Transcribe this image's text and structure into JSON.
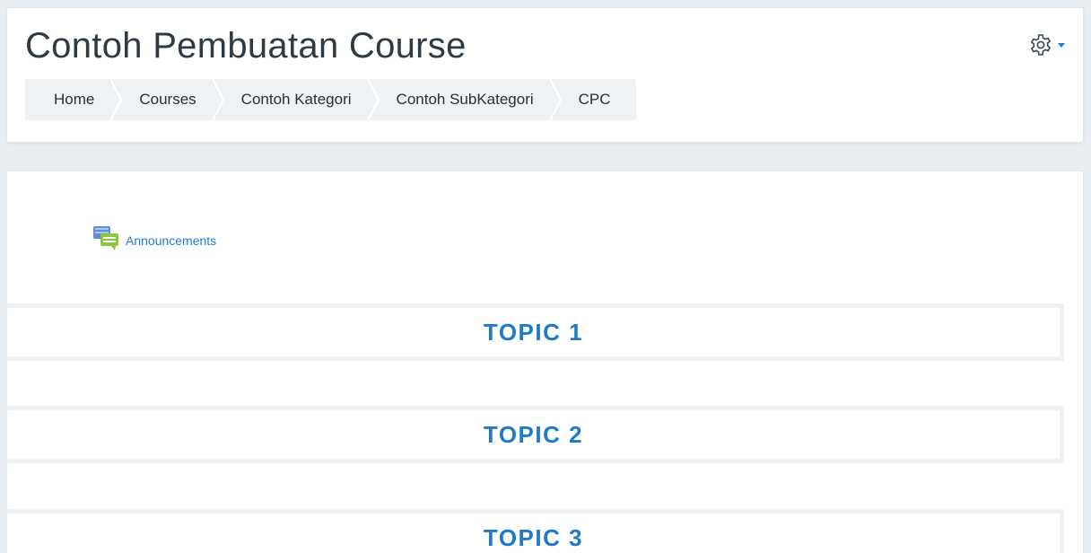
{
  "header": {
    "title": "Contoh Pembuatan Course",
    "settings_icon": "gear-icon",
    "menu_icon": "caret-down-icon"
  },
  "breadcrumb": [
    {
      "label": "Home"
    },
    {
      "label": "Courses"
    },
    {
      "label": "Contoh Kategori"
    },
    {
      "label": "Contoh SubKategori"
    },
    {
      "label": "CPC"
    }
  ],
  "content": {
    "activities": [
      {
        "label": "Announcements",
        "icon": "forum-icon"
      }
    ],
    "topics": [
      {
        "title": "TOPIC 1"
      },
      {
        "title": "TOPIC 2"
      },
      {
        "title": "TOPIC 3"
      }
    ]
  },
  "colors": {
    "accent": "#1f7bc9",
    "background": "#e8edf1",
    "breadcrumb_bg": "#eef2f5",
    "title_text": "#2f3a44"
  }
}
